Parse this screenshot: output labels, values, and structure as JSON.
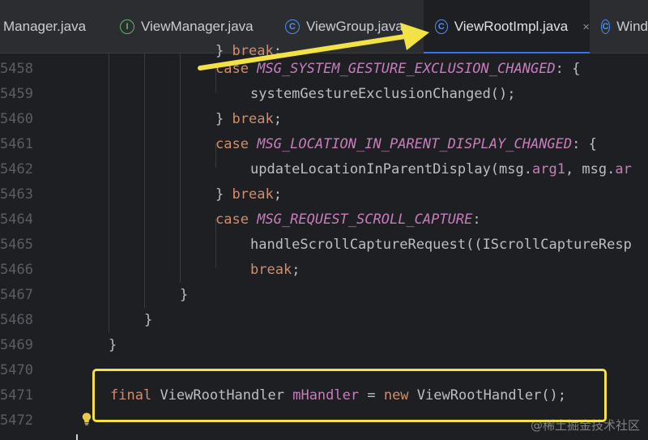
{
  "tabs": [
    {
      "label": "Manager.java",
      "icon": "",
      "active": false
    },
    {
      "label": "ViewManager.java",
      "icon": "I",
      "icon_name": "interface-icon",
      "active": false
    },
    {
      "label": "ViewGroup.java",
      "icon": "C",
      "icon_name": "class-icon",
      "active": false
    },
    {
      "label": "ViewRootImpl.java",
      "icon": "C",
      "icon_name": "class-icon",
      "active": true,
      "close": "×"
    },
    {
      "label": "Wind",
      "icon": "C",
      "icon_name": "class-icon",
      "active": false
    }
  ],
  "editor": {
    "partial_top_line": "} break;",
    "lines": [
      {
        "num": "5458"
      },
      {
        "num": "5459"
      },
      {
        "num": "5460"
      },
      {
        "num": "5461"
      },
      {
        "num": "5462"
      },
      {
        "num": "5463"
      },
      {
        "num": "5464"
      },
      {
        "num": "5465"
      },
      {
        "num": "5466"
      },
      {
        "num": "5467"
      },
      {
        "num": "5468"
      },
      {
        "num": "5469"
      },
      {
        "num": "5470"
      },
      {
        "num": "5471"
      },
      {
        "num": "5472"
      }
    ],
    "tokens": {
      "case": "case",
      "break": "break",
      "close_brace": "}",
      "gesture_const": "MSG_SYSTEM_GESTURE_EXCLUSION_CHANGED",
      "gesture_call": "systemGestureExclusionChanged();",
      "location_const": "MSG_LOCATION_IN_PARENT_DISPLAY_CHANGED",
      "location_call_a": "updateLocationInParentDisplay(msg.",
      "location_call_b": "arg1",
      "location_call_c": ", msg.",
      "location_call_d": "ar",
      "scroll_const": "MSG_REQUEST_SCROLL_CAPTURE",
      "scroll_call": "handleScrollCaptureRequest((IScrollCaptureResp",
      "final": "final",
      "new": "new",
      "handler_type": "ViewRootHandler",
      "handler_field": "mHandler",
      "handler_rhs": "ViewRootHandler();"
    }
  },
  "colors": {
    "highlight_box": "#f3e245",
    "arrow": "#f3e245",
    "keyword": "#cf8e6d",
    "constant": "#c77dbb",
    "background": "#1e1f22"
  },
  "watermark": "@稀土掘金技术社区"
}
